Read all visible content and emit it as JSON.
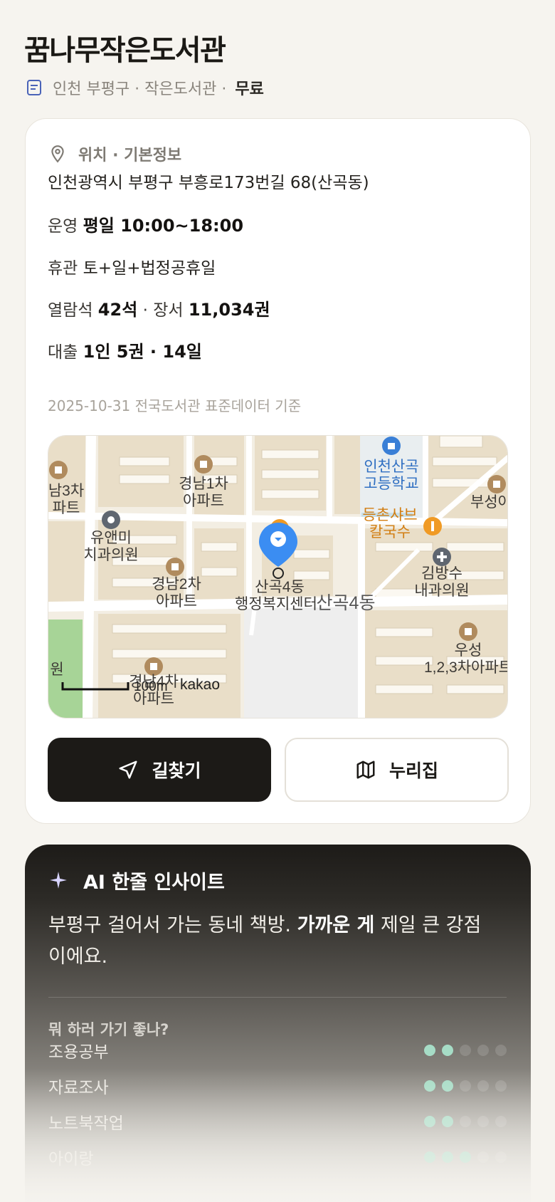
{
  "header": {
    "title": "꿈나무작은도서관",
    "region_type": "인천 부평구 · 작은도서관 ·",
    "fee": "무료"
  },
  "info": {
    "section_title": "위치 · 기본정보",
    "address": "인천광역시 부평구 부흥로173번길 68(산곡동)",
    "hours_label": "운영",
    "hours_value": "평일 10:00~18:00",
    "closed_label": "휴관",
    "closed_value": "토+일+법정공휴일",
    "seats_label": "열람석",
    "seats_value": "42석",
    "books_label": "· 장서",
    "books_value": "11,034권",
    "loan_label": "대출",
    "loan_value": "1인 5권 · 14일",
    "data_source": "2025-10-31 전국도서관 표준데이터 기준"
  },
  "map": {
    "labels": {
      "gyeongnam1": [
        "경남1차",
        "아파트"
      ],
      "gyeongnam2": [
        "경남2차",
        "아파트"
      ],
      "gyeongnam3": [
        "남3차",
        "파트"
      ],
      "gyeongnam4": [
        "경남4차",
        "아파트"
      ],
      "dental": [
        "유앤미",
        "치과의원"
      ],
      "school": [
        "인천산곡",
        "고등학교"
      ],
      "restaurant": [
        "등촌샤브",
        "칼국수"
      ],
      "clinic": [
        "김방수",
        "내과의원"
      ],
      "buseong": "부성아",
      "useong": [
        "우성",
        "1,2,3차아파트"
      ],
      "center": [
        "산곡4동",
        "행정복지센터"
      ],
      "district": "산곡4동",
      "park": "원",
      "scale": "100m",
      "brand": "kakao"
    },
    "colors": {
      "base": "#f2ede1",
      "block": "#e7dcc6",
      "park": "#9fcf8f",
      "pin": "#3b8df2",
      "poi_apt": "#b08b5e",
      "food": "#f09a24"
    }
  },
  "actions": {
    "directions": "길찾기",
    "nurijip": "누리집"
  },
  "ai": {
    "title": "AI 한줄 인사이트",
    "text_prefix": "부평구 걸어서 가는 동네 책방.",
    "text_bold": "가까운 게",
    "text_suffix": "제일 큰 강점이에요.",
    "question": "뭐 하러 가기 좋나?",
    "activities": [
      {
        "name": "조용공부",
        "score": 2
      },
      {
        "name": "자료조사",
        "score": 2
      },
      {
        "name": "노트북작업",
        "score": 2
      },
      {
        "name": "아이랑",
        "score": 3
      }
    ],
    "colors": {
      "dot_on": "#a6dcc6"
    }
  }
}
